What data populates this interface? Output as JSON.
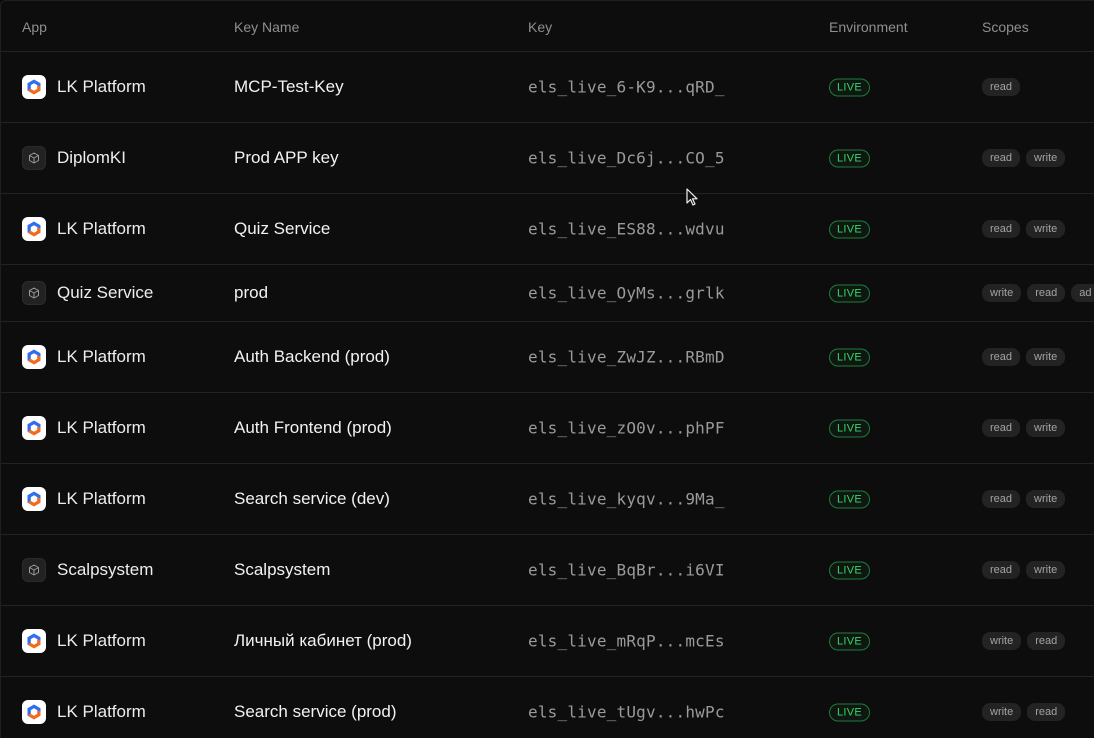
{
  "columns": {
    "app": "App",
    "key_name": "Key Name",
    "key": "Key",
    "environment": "Environment",
    "scopes": "Scopes"
  },
  "colors": {
    "live_text": "#37d26b",
    "live_border": "#1f7a3d",
    "brand_icon_orange": "#f26b1d",
    "brand_icon_blue": "#2f6fed"
  },
  "rows": [
    {
      "app": "LK Platform",
      "icon": "lk-platform-logo-icon",
      "key_name": "MCP-Test-Key",
      "key": "els_live_6-K9...qRD_",
      "env": "LIVE",
      "scopes": [
        "read"
      ]
    },
    {
      "app": "DiplomKI",
      "icon": "cube-icon",
      "key_name": "Prod APP key",
      "key": "els_live_Dc6j...CO_5",
      "env": "LIVE",
      "scopes": [
        "read",
        "write"
      ]
    },
    {
      "app": "LK Platform",
      "icon": "lk-platform-logo-icon",
      "key_name": "Quiz Service",
      "key": "els_live_ES88...wdvu",
      "env": "LIVE",
      "scopes": [
        "read",
        "write"
      ]
    },
    {
      "app": "Quiz Service",
      "icon": "cube-icon",
      "key_name": "prod",
      "key": "els_live_OyMs...grlk",
      "env": "LIVE",
      "scopes": [
        "write",
        "read",
        "ad"
      ]
    },
    {
      "app": "LK Platform",
      "icon": "lk-platform-logo-icon",
      "key_name": "Auth Backend (prod)",
      "key": "els_live_ZwJZ...RBmD",
      "env": "LIVE",
      "scopes": [
        "read",
        "write"
      ]
    },
    {
      "app": "LK Platform",
      "icon": "lk-platform-logo-icon",
      "key_name": "Auth Frontend (prod)",
      "key": "els_live_zO0v...phPF",
      "env": "LIVE",
      "scopes": [
        "read",
        "write"
      ]
    },
    {
      "app": "LK Platform",
      "icon": "lk-platform-logo-icon",
      "key_name": "Search service (dev)",
      "key": "els_live_kyqv...9Ma_",
      "env": "LIVE",
      "scopes": [
        "read",
        "write"
      ]
    },
    {
      "app": "Scalpsystem",
      "icon": "cube-icon",
      "key_name": "Scalpsystem",
      "key": "els_live_BqBr...i6VI",
      "env": "LIVE",
      "scopes": [
        "read",
        "write"
      ]
    },
    {
      "app": "LK Platform",
      "icon": "lk-platform-logo-icon",
      "key_name": "Личный кабинет (prod)",
      "key": "els_live_mRqP...mcEs",
      "env": "LIVE",
      "scopes": [
        "write",
        "read"
      ]
    },
    {
      "app": "LK Platform",
      "icon": "lk-platform-logo-icon",
      "key_name": "Search service (prod)",
      "key": "els_live_tUgv...hwPc",
      "env": "LIVE",
      "scopes": [
        "write",
        "read"
      ]
    }
  ]
}
